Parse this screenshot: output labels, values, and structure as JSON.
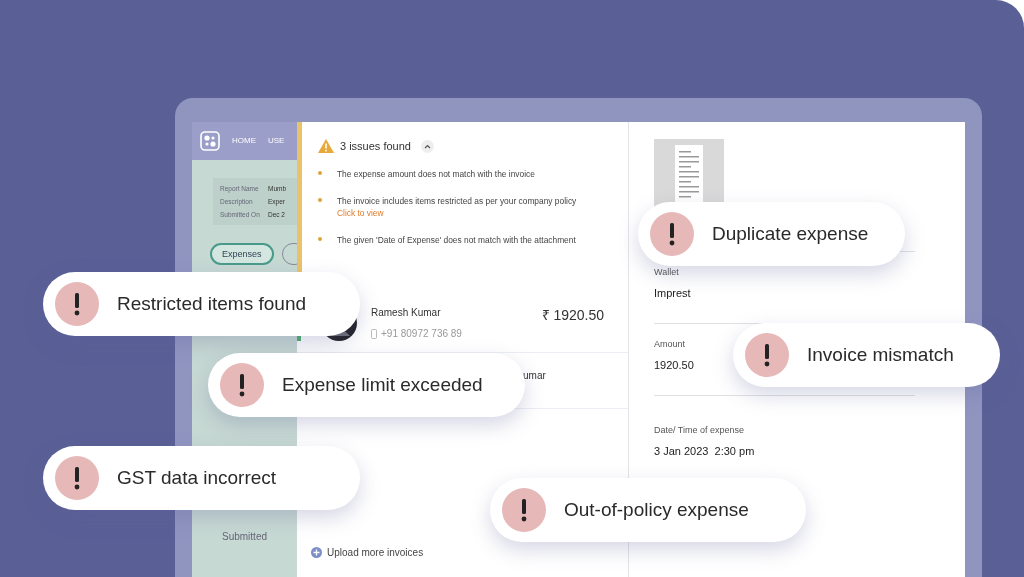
{
  "sidebar": {
    "nav": [
      "HOME",
      "USE"
    ],
    "report_fields": [
      {
        "label": "Report Name",
        "value": "Mumb"
      },
      {
        "label": "Description",
        "value": "Exper"
      },
      {
        "label": "Submitted On",
        "value": "Dec 2"
      }
    ],
    "tabs": [
      {
        "label": "Expenses",
        "selected": true
      },
      {
        "selected": false
      }
    ],
    "status": "Submitted"
  },
  "issues": {
    "title": "3 issues found",
    "expanded": true,
    "items": [
      {
        "text": "The expense amount does not match with the invoice"
      },
      {
        "text": "The invoice includes items restricted as per your company policy",
        "link": "Click to view"
      },
      {
        "text": "The given 'Date of Expense' does not match with the attachment"
      }
    ]
  },
  "expenses": [
    {
      "name": "Ramesh Kumar",
      "phone": "+91 80972 736 89",
      "amount": "₹ 1920.50",
      "selected": true
    },
    {
      "name": "umar"
    }
  ],
  "upload_link": "Upload more invoices",
  "details": [
    {
      "label": "Wallet",
      "value": "Imprest"
    },
    {
      "label": "Amount",
      "value": "1920.50"
    },
    {
      "label": "Date/ Time of expense",
      "value": "3 Jan 2023  2:30 pm"
    }
  ],
  "alerts": [
    "Restricted items found",
    "Expense limit exceeded",
    "GST data incorrect",
    "Out-of-policy expense",
    "Duplicate expense",
    "Invoice mismatch"
  ]
}
